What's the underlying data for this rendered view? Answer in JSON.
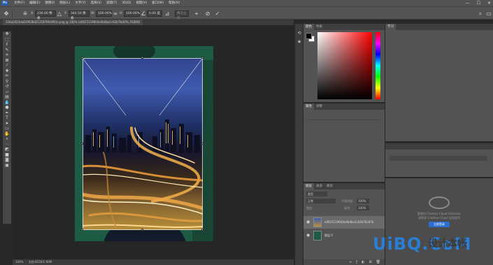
{
  "menubar": {
    "logo": "Ps",
    "items": [
      "文件(F)",
      "编辑(E)",
      "图像(I)",
      "图层(L)",
      "文字(Y)",
      "选择(S)",
      "滤镜(T)",
      "3D(D)",
      "视图(V)",
      "窗口(W)",
      "帮助(H)"
    ],
    "minimize": "—",
    "maximize": "☐",
    "close": "✕"
  },
  "options": {
    "x_label": "X:",
    "x_value": "236.00 像素",
    "y_label": "Y:",
    "y_value": "344.50 像素",
    "w_label": "W:",
    "w_value": "100.00%",
    "h_label": "H:",
    "h_value": "100.00%",
    "angle_value": "0.00 度",
    "interp_value": "两次立方"
  },
  "document": {
    "tab_title": "334a2423aa01963842121878fc6f61c.png @ 100% (e0625119664e4b4ba1c62b78c87b, RGB/8)"
  },
  "panels": {
    "color_tabs": [
      "颜色",
      "色板"
    ],
    "learn_tab": "学习",
    "props_tabs": [
      "属性",
      "调整"
    ],
    "layers_tabs": [
      "图层",
      "通道",
      "路径"
    ],
    "layers_kind": "类型",
    "layers_blend": "正常",
    "layers_opacity_label": "不透明度:",
    "layers_opacity": "100%",
    "layers_lock_label": "锁定:",
    "layers_fill_label": "填充:",
    "layers_fill": "100%",
    "layers": [
      {
        "name": "e0625119664e4b4ba1c62b78c87b",
        "active": true
      },
      {
        "name": "图层 0",
        "active": false
      }
    ],
    "cc_line1": "要使用 Creative Cloud Libraries,",
    "cc_line2": "请登录 Creative Cloud 应用程序",
    "cc_button": "立即登录"
  },
  "status": {
    "zoom": "100%",
    "doc": "文档:815K/1.90M"
  },
  "watermark": {
    "latin": "UiBQ.CoM",
    "chinese": "设计本帐"
  },
  "colors": {
    "accent": "#2a7fd4",
    "ui_bg": "#535353",
    "workspace": "#282828"
  }
}
